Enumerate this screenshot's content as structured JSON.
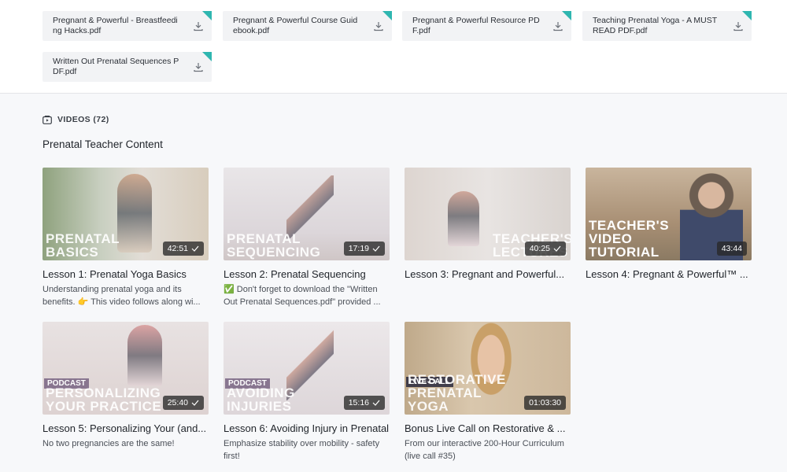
{
  "files": [
    {
      "name": "Pregnant & Powerful - Breastfeeding Hacks.pdf"
    },
    {
      "name": "Pregnant & Powerful Course Guidebook.pdf"
    },
    {
      "name": "Pregnant & Powerful Resource PDF.pdf"
    },
    {
      "name": "Teaching Prenatal Yoga - A MUST READ PDF.pdf"
    },
    {
      "name": "Written Out Prenatal Sequences PDF.pdf"
    }
  ],
  "videos_header": "VIDEOS (72)",
  "section_title": "Prenatal Teacher Content",
  "videos": [
    {
      "title": "Lesson 1: Prenatal Yoga Basics",
      "desc": "Understanding prenatal yoga and its benefits. 👉 This video follows along wi...",
      "duration": "42:51",
      "overlay": "PRENATAL BASICS",
      "watched": true
    },
    {
      "title": "Lesson 2: Prenatal Sequencing",
      "desc": "✅ Don't forget to download the \"Written Out Prenatal Sequences.pdf\" provided ...",
      "duration": "17:19",
      "overlay": "PRENATAL SEQUENCING",
      "watched": true
    },
    {
      "title": "Lesson 3: Pregnant and Powerful...",
      "desc": "",
      "duration": "40:25",
      "overlay": "TEACHER'S LECTURES",
      "watched": true
    },
    {
      "title": "Lesson 4: Pregnant & Powerful™ ...",
      "desc": "",
      "duration": "43:44",
      "overlay": "TEACHER'S VIDEO TUTORIAL",
      "watched": false
    },
    {
      "title": "Lesson 5: Personalizing Your (and...",
      "desc": "No two pregnancies are the same!",
      "duration": "25:40",
      "overlay": "PERSONALIZING YOUR PRACTICE",
      "tag": "PODCAST",
      "watched": true
    },
    {
      "title": "Lesson 6: Avoiding Injury in Prenatal",
      "desc": "Emphasize stability over mobility - safety first!",
      "duration": "15:16",
      "overlay": "AVOIDING INJURIES",
      "tag": "PODCAST",
      "watched": true
    },
    {
      "title": "Bonus Live Call on Restorative & ...",
      "desc": "From our interactive 200-Hour Curriculum (live call #35)",
      "duration": "01:03:30",
      "overlay": "RESTORATIVE PRENATAL YOGA",
      "tag": "LIVE CALL",
      "watched": false
    }
  ],
  "colors": {
    "accent": "#2fb6b0",
    "background": "#f7f8fa"
  }
}
